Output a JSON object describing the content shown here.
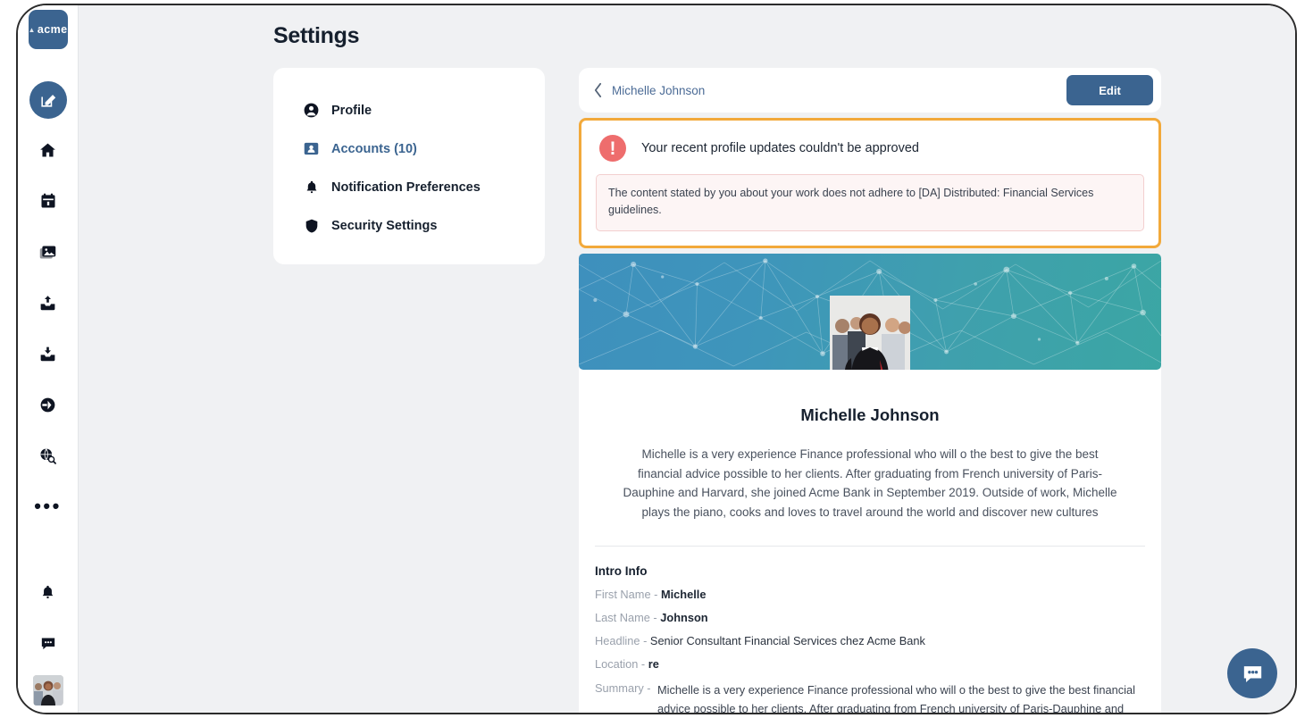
{
  "app": {
    "logo_text": "acme"
  },
  "rail": {
    "items": [
      {
        "name": "compose",
        "icon": "compose-icon"
      },
      {
        "name": "home",
        "icon": "home-icon"
      },
      {
        "name": "calendar",
        "icon": "calendar-icon"
      },
      {
        "name": "media",
        "icon": "images-icon"
      },
      {
        "name": "outbox",
        "icon": "outbox-upload-icon"
      },
      {
        "name": "inbox",
        "icon": "inbox-download-icon"
      },
      {
        "name": "share",
        "icon": "share-circle-icon"
      },
      {
        "name": "discover",
        "icon": "globe-search-icon"
      },
      {
        "name": "more",
        "icon": "more-dots-icon"
      }
    ],
    "bottom_items": [
      {
        "name": "notifications",
        "icon": "bell-icon"
      },
      {
        "name": "messages",
        "icon": "chat-bubble-icon"
      },
      {
        "name": "account-avatar",
        "icon": "avatar-photo"
      }
    ]
  },
  "header": {
    "title": "Settings"
  },
  "settings_menu": {
    "items": [
      {
        "label": "Profile",
        "icon": "person-circle-icon",
        "active": false
      },
      {
        "label": "Accounts (10)",
        "icon": "id-badge-icon",
        "active": true
      },
      {
        "label": "Notification Preferences",
        "icon": "bell-icon",
        "active": false
      },
      {
        "label": "Security Settings",
        "icon": "shield-icon",
        "active": false
      }
    ]
  },
  "profile_header": {
    "back_icon": "chevron-left-icon",
    "breadcrumb_name": "Michelle Johnson",
    "edit_label": "Edit"
  },
  "alert": {
    "icon": "exclamation-circle-icon",
    "title": "Your recent profile updates couldn't be approved",
    "detail": "The content stated by you about your work does not adhere to [DA] Distributed: Financial Services guidelines."
  },
  "profile": {
    "name": "Michelle Johnson",
    "bio": "Michelle is a very experience Finance professional who will o the best to give the best financial advice possible to her clients. After graduating from French university of Paris-Dauphine and Harvard, she joined Acme Bank in September 2019. Outside of work, Michelle plays the piano, cooks and loves to travel around the world and discover new cultures",
    "intro_title": "Intro Info",
    "fields": [
      {
        "label": "First Name -",
        "value": "Michelle",
        "bold": true
      },
      {
        "label": "Last Name -",
        "value": "Johnson",
        "bold": true
      },
      {
        "label": "Headline -",
        "value": "Senior Consultant Financial Services chez Acme Bank",
        "bold": false
      },
      {
        "label": "Location -",
        "value": "re",
        "bold": true
      }
    ],
    "summary_label": "Summary -",
    "summary_text": "Michelle is a very experience Finance professional who will o the best to give the best financial advice possible to her clients. After graduating from French university of Paris-Dauphine and"
  },
  "chat_widget": {
    "icon": "chat-bubble-icon"
  },
  "colors": {
    "brand_blue": "#3b6490",
    "alert_border": "#f2a93b",
    "alert_badge": "#ee6d6d",
    "page_bg": "#f0f1f3",
    "banner_start": "#3e90bd",
    "banner_end": "#3ba6a4"
  }
}
